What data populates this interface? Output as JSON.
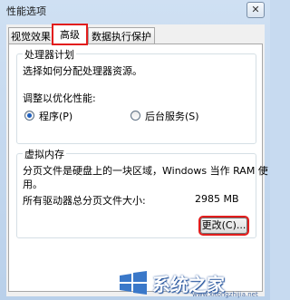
{
  "window": {
    "title": "性能选项",
    "close_glyph": "✕"
  },
  "tabs": [
    {
      "label": "视觉效果",
      "selected": false
    },
    {
      "label": "高级",
      "selected": true
    },
    {
      "label": "数据执行保护",
      "selected": false
    }
  ],
  "processor": {
    "group_title": "处理器计划",
    "description": "选择如何分配处理器资源。",
    "adjust_label": "调整以优化性能:",
    "options": [
      {
        "label": "程序(P)",
        "checked": true
      },
      {
        "label": "后台服务(S)",
        "checked": false
      }
    ]
  },
  "virtual_memory": {
    "group_title": "虚拟内存",
    "description_line1": "分页文件是硬盘上的一块区域，Windows 当作 RAM 使",
    "description_line2": "用。",
    "total_label": "所有驱动器总分页文件大小:",
    "total_value": "2985 MB",
    "change_button": "更改(C)..."
  },
  "watermark": {
    "text": "系统之家",
    "url": "www.xitongzhijia.net",
    "logo": "windows-logo-icon",
    "accent": "#1f4f9a"
  },
  "colors": {
    "highlight_red": "#e21d1d",
    "radio_dot": "#1e5fbf"
  }
}
